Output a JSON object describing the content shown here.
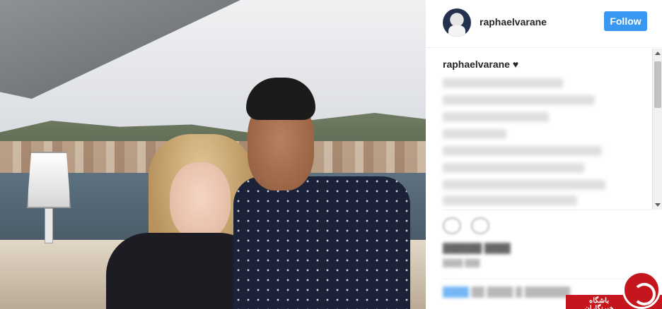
{
  "post": {
    "username": "raphaelvarane",
    "follow_label": "Follow",
    "caption_username": "raphaelvarane",
    "caption_text": "♥"
  },
  "watermark": {
    "text": "باشگاه خبرنگاران"
  },
  "icons": {
    "like": "heart-icon",
    "comment": "comment-icon"
  },
  "colors": {
    "follow_button": "#3897f0",
    "watermark": "#c4161c"
  }
}
